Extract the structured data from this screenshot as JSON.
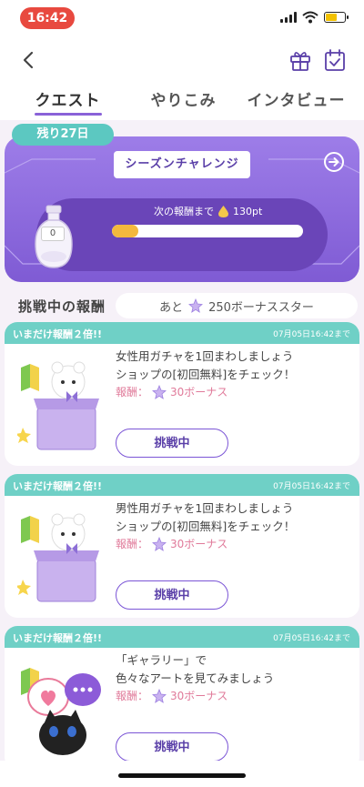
{
  "status_bar": {
    "time": "16:42"
  },
  "header": {
    "tabs": [
      {
        "label": "クエスト",
        "active": true
      },
      {
        "label": "やりこみ",
        "active": false
      },
      {
        "label": "インタビュー",
        "active": false
      }
    ]
  },
  "season": {
    "days_left": "残り27日",
    "title": "シーズンチャレンジ",
    "bottle_value": "0",
    "next_reward_label": "次の報酬まで",
    "next_reward_points": "130pt",
    "progress_fraction": 0.14
  },
  "reward_summary": {
    "label": "挑戦中の報酬",
    "prefix": "あと",
    "remaining": "250ボーナススター"
  },
  "quests": [
    {
      "banner": "いまだけ報酬２倍!!",
      "deadline": "07月05日16:42まで",
      "line1": "女性用ガチャを1回まわしましょう",
      "line2": "ショップの[初回無料]をチェック！",
      "reward_label": "報酬：",
      "reward_value": "30ボーナス",
      "button": "挑戦中",
      "art": "gift-box-bear"
    },
    {
      "banner": "いまだけ報酬２倍!!",
      "deadline": "07月05日16:42まで",
      "line1": "男性用ガチャを1回まわしましょう",
      "line2": "ショップの[初回無料]をチェック！",
      "reward_label": "報酬：",
      "reward_value": "30ボーナス",
      "button": "挑戦中",
      "art": "gift-box-bear"
    },
    {
      "banner": "いまだけ報酬２倍!!",
      "deadline": "07月05日16:42まで",
      "line1": "「ギャラリー」で",
      "line2": "色々なアートを見てみましょう",
      "reward_label": "報酬：",
      "reward_value": "30ボーナス",
      "button": "挑戦中",
      "art": "black-cat-speech"
    }
  ],
  "colors": {
    "accent": "#8a62d8",
    "teal": "#6fd0c6",
    "reward_pink": "#e07a9a",
    "time_pill": "#e8493f"
  }
}
